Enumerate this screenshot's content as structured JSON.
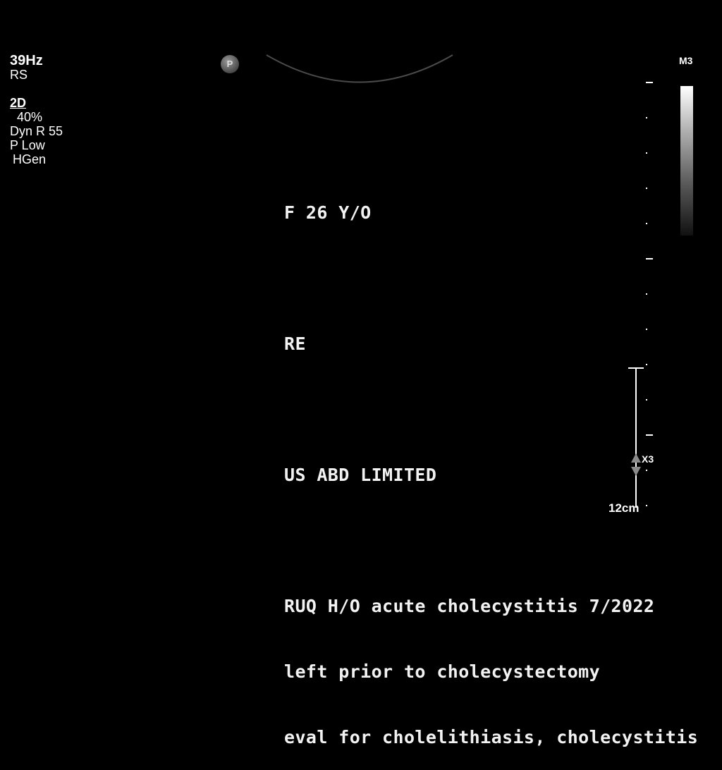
{
  "params": {
    "frame_rate": "39Hz",
    "rs": "RS",
    "mode": "2D",
    "gain": "40%",
    "dyn_range": "Dyn R 55",
    "power": "P Low",
    "harmonic": "HGen"
  },
  "probe_icon": {
    "label": "P",
    "icon": "probe-orientation-marker"
  },
  "annotation": {
    "patient": "F 26 Y/O",
    "initials": "RE",
    "exam": "US ABD LIMITED",
    "history_line1": "RUQ H/O acute cholecystitis 7/2022",
    "history_line2": "left prior to cholecystectomy",
    "history_line3": "eval for cholelithiasis, cholecystitis"
  },
  "gray_map": {
    "label": "M3"
  },
  "depth": {
    "zoom": "X3",
    "max_depth": "12cm"
  }
}
